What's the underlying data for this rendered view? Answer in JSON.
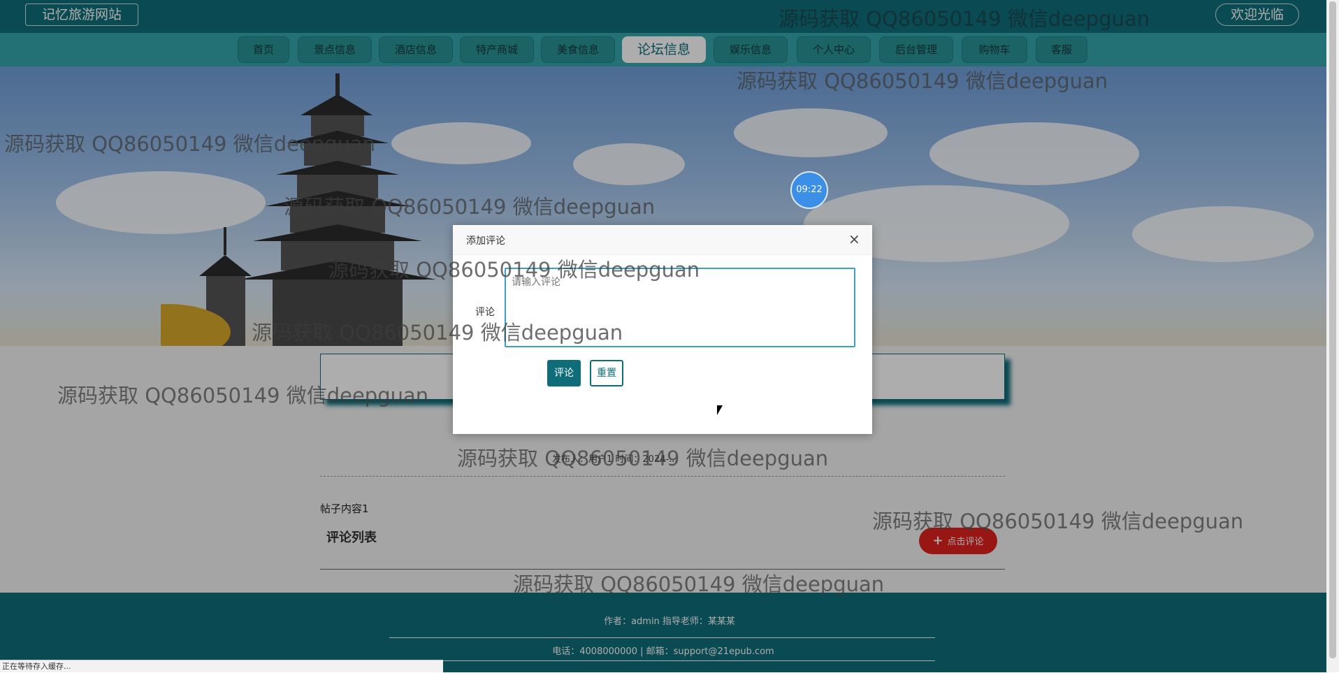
{
  "header": {
    "site_title": "记忆旅游网站",
    "welcome": "欢迎光临"
  },
  "nav": [
    {
      "label": "首页"
    },
    {
      "label": "景点信息"
    },
    {
      "label": "酒店信息"
    },
    {
      "label": "特产商城"
    },
    {
      "label": "美食信息"
    },
    {
      "label": "论坛信息"
    },
    {
      "label": "娱乐信息"
    },
    {
      "label": "个人中心"
    },
    {
      "label": "后台管理"
    },
    {
      "label": "购物车"
    },
    {
      "label": "客服"
    }
  ],
  "active_nav": "论坛信息",
  "clock": "09:22",
  "post": {
    "meta": "发布人：用户1 时间：2024-...",
    "content": "帖子内容1",
    "comment_list_title": "评论列表",
    "comment_button": "点击评论"
  },
  "dialog": {
    "title": "添加评论",
    "close": "×",
    "field_label": "评论",
    "placeholder": "请输入评论",
    "submit": "评论",
    "reset": "重置"
  },
  "footer": {
    "line1": "作者：admin 指导老师：某某某",
    "line2": "电话：4008000000 | 邮箱：support@21epub.com"
  },
  "watermark": "源码获取 QQ86050149 微信deepguan",
  "statusbar": "正在等待存入缓存...",
  "colors": {
    "primary": "#0f6d7a",
    "nav_bg": "#34a7ab",
    "comment_button": "#e0231f"
  }
}
